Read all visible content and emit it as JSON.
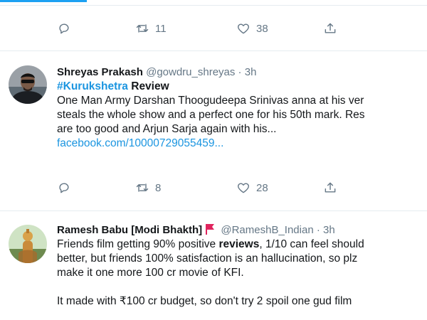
{
  "tweet0": {
    "reply_count": "",
    "retweet_count": "11",
    "like_count": "38"
  },
  "tweet1": {
    "name": "Shreyas Prakash",
    "handle": "@gowdru_shreyas",
    "time": "3h",
    "hashtag": "#Kurukshetra",
    "title_rest": " Review",
    "lines": [
      "One Man Army Darshan Thoogudeepa Srinivas anna at his ver",
      "steals the whole show and a perfect one for his 50th mark. Res",
      "are too good and Arjun Sarja again with his..."
    ],
    "link": "facebook.com/10000729055459...",
    "retweet_count": "8",
    "like_count": "28"
  },
  "tweet2": {
    "name": "Ramesh Babu [Modi Bhakth]",
    "handle": "@RameshB_Indian",
    "time": "3h",
    "line1_pre": "Friends film getting 90% positive ",
    "line1_bold": "reviews",
    "line1_post": ", 1/10 can feel should",
    "lines": [
      "better, but friends 100% satisfaction is an hallucination, so plz",
      "make it one more 100 cr movie of KFI."
    ],
    "cut_line": "It made with ₹100 cr budget, so don't try 2 spoil one gud film"
  },
  "separator": " · ",
  "icons": [
    "reply-icon",
    "retweet-icon",
    "like-icon",
    "share-icon",
    "flag-icon"
  ],
  "colors": {
    "accent": "#1da1f2",
    "link": "#1b95e0",
    "secondary": "#657786",
    "flag": "#e0245e"
  }
}
